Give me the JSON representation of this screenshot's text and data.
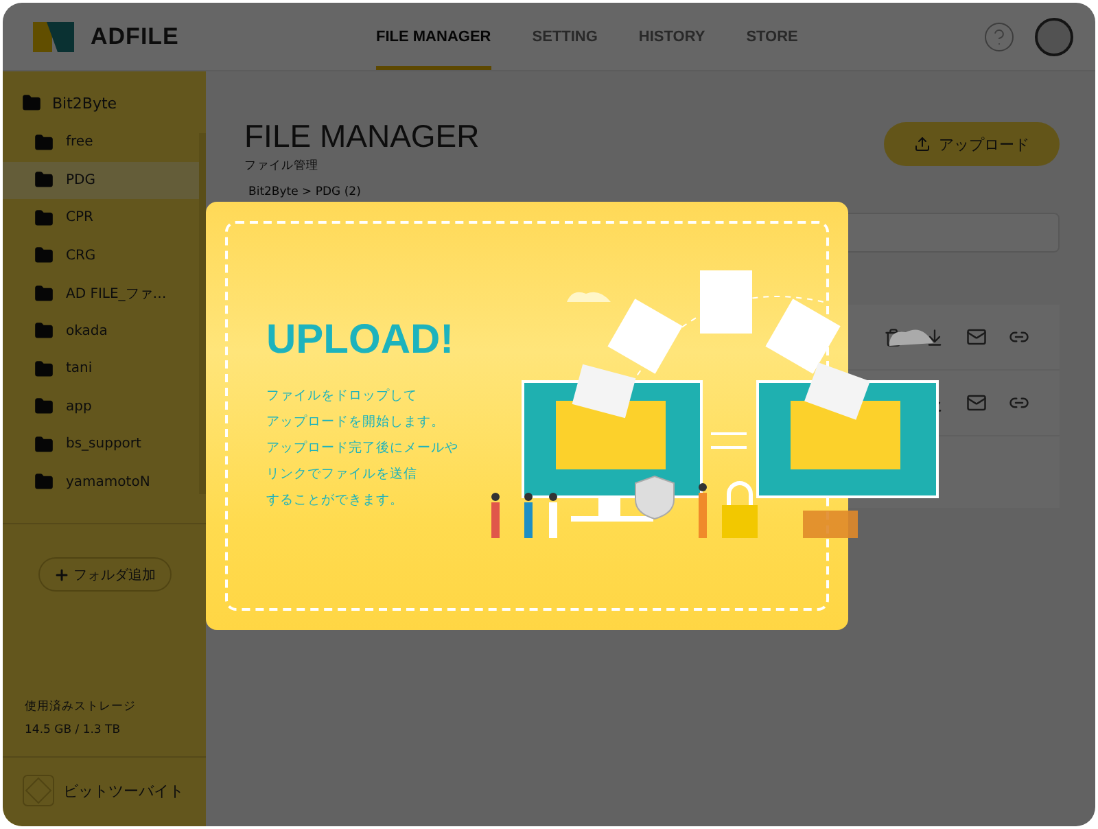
{
  "header": {
    "logo": "ADFILE",
    "tabs": [
      {
        "label": "FILE MANAGER",
        "selected": true
      },
      {
        "label": "SETTING",
        "selected": false
      },
      {
        "label": "HISTORY",
        "selected": false
      },
      {
        "label": "STORE",
        "selected": false
      }
    ]
  },
  "sidebar": {
    "root": "Bit2Byte",
    "items": [
      {
        "label": "free",
        "selected": false
      },
      {
        "label": "PDG",
        "selected": true
      },
      {
        "label": "CPR",
        "selected": false
      },
      {
        "label": "CRG",
        "selected": false
      },
      {
        "label": "AD FILE_ファ…",
        "selected": false
      },
      {
        "label": "okada",
        "selected": false
      },
      {
        "label": "tani",
        "selected": false
      },
      {
        "label": "app",
        "selected": false
      },
      {
        "label": "bs_support",
        "selected": false
      },
      {
        "label": "yamamotoN",
        "selected": false
      }
    ],
    "add_folder": "フォルダ追加",
    "storage_label": "使用済みストレージ",
    "storage_value": "14.5 GB / 1.3 TB",
    "company": "ビットツーバイト"
  },
  "main": {
    "title": "FILE MANAGER",
    "subtitle": "ファイル管理",
    "breadcrumb": "Bit2Byte > PDG (2)",
    "upload_button": "アップロード"
  },
  "modal": {
    "heading": "UPLOAD!",
    "lines": [
      "ファイルをドロップして",
      "アップロードを開始します。",
      "アップロード完了後にメールや",
      "リンクでファイルを送信",
      "することができます。"
    ]
  }
}
